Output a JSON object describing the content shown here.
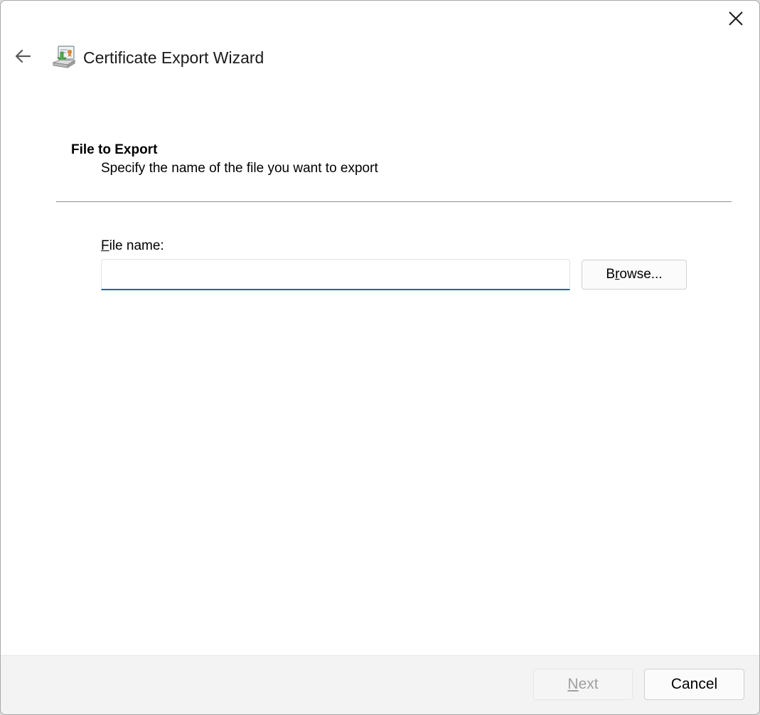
{
  "window": {
    "title": "Certificate Export Wizard",
    "close_icon": "close-icon",
    "back_icon": "back-arrow-icon",
    "app_icon": "certificate-wizard-icon"
  },
  "page": {
    "heading": "File to Export",
    "subheading": "Specify the name of the file you want to export"
  },
  "form": {
    "file_name_label_accel": "F",
    "file_name_label_rest": "ile name:",
    "file_name_value": "",
    "browse_pre": "B",
    "browse_accel": "r",
    "browse_rest": "owse..."
  },
  "footer": {
    "next_accel": "N",
    "next_rest": "ext",
    "next_enabled": false,
    "cancel_label": "Cancel"
  },
  "colors": {
    "accent": "#1f63b0",
    "footer_bg": "#f3f3f3",
    "disabled_text": "#a0a0a0"
  }
}
